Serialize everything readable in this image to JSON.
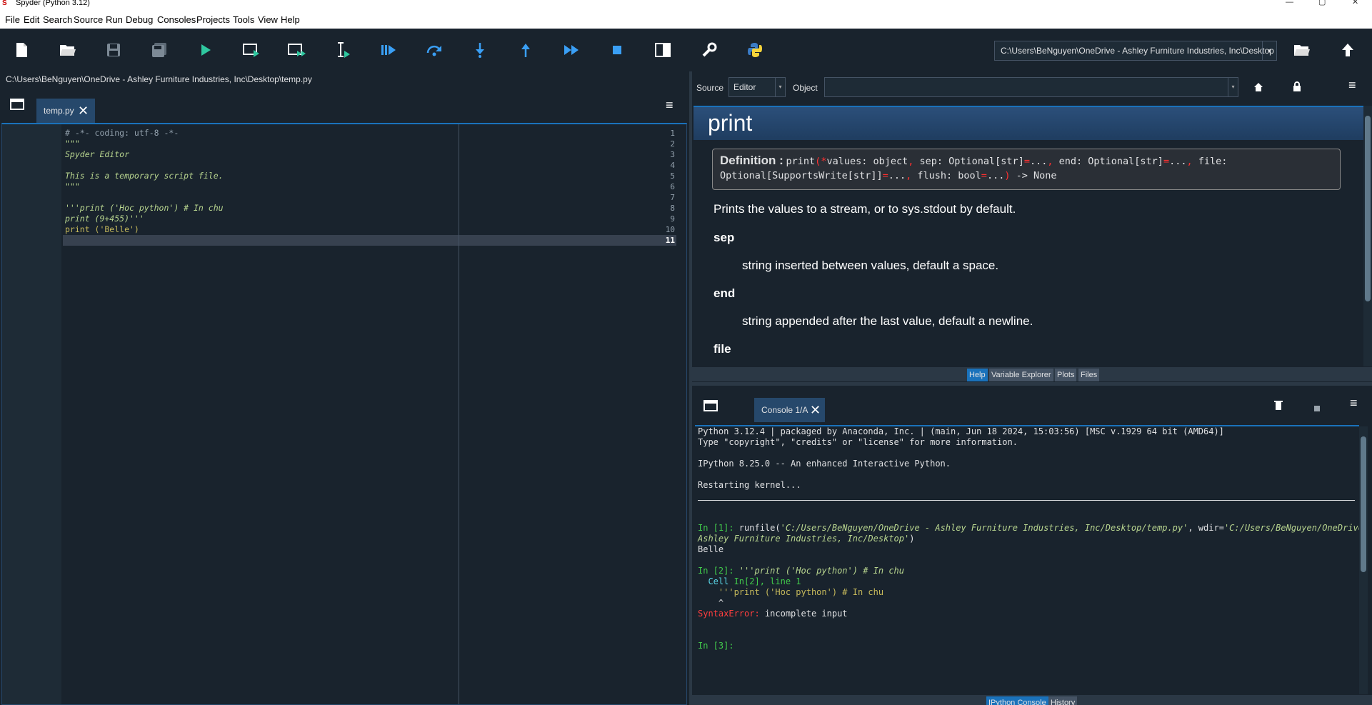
{
  "window": {
    "title": "Spyder (Python 3.12)",
    "logo": "S"
  },
  "menu": [
    "File",
    "Edit",
    "Search",
    "Source",
    "Run",
    "Debug",
    "Consoles",
    "Projects",
    "Tools",
    "View",
    "Help"
  ],
  "toolbar": {
    "icons": [
      "new-file-icon",
      "open-file-icon",
      "save-icon",
      "save-all-icon",
      "run-icon",
      "run-cell-icon",
      "run-cell-advance-icon",
      "run-selection-icon",
      "debug-file-icon",
      "step-over-icon",
      "step-into-icon",
      "step-return-icon",
      "continue-icon",
      "stop-debug-icon",
      "maximize-pane-icon",
      "preferences-wrench-icon",
      "python-path-icon"
    ],
    "working_dir": "C:\\Users\\BeNguyen\\OneDrive - Ashley Furniture Industries, Inc\\Desktop"
  },
  "editor": {
    "path": "C:\\Users\\BeNguyen\\OneDrive - Ashley Furniture Industries, Inc\\Desktop\\temp.py",
    "tab": "temp.py",
    "line_numbers": [
      "1",
      "2",
      "3",
      "4",
      "5",
      "6",
      "7",
      "8",
      "9",
      "10",
      "11"
    ],
    "lines": [
      "# -*- coding: utf-8 -*-",
      "\"\"\"",
      "Spyder Editor",
      "",
      "This is a temporary script file.",
      "\"\"\"",
      "",
      "'''print ('Hoc python') # In chu",
      "print (9+455)'''",
      "print ('Belle')",
      ""
    ],
    "colors": {
      "comment": "#93a1ad",
      "string": "#b8d58f",
      "keyword": "#c6b95b",
      "default": "#e0e1e3"
    }
  },
  "help": {
    "source_label": "Source",
    "source_value": "Editor",
    "object_label": "Object",
    "object_value": "",
    "title": "print",
    "definition_label": "Definition :",
    "definition_parts": [
      {
        "t": "print",
        "c": "n"
      },
      {
        "t": "(",
        "c": "r"
      },
      {
        "t": "*",
        "c": "r"
      },
      {
        "t": "values: object",
        "c": "n"
      },
      {
        "t": ",",
        "c": "r"
      },
      {
        "t": " sep: Optional[str]",
        "c": "n"
      },
      {
        "t": "=",
        "c": "r"
      },
      {
        "t": "...",
        "c": "n"
      },
      {
        "t": ",",
        "c": "r"
      },
      {
        "t": " end: Optional[str]",
        "c": "n"
      },
      {
        "t": "=",
        "c": "r"
      },
      {
        "t": "...",
        "c": "n"
      },
      {
        "t": ",",
        "c": "r"
      },
      {
        "t": " file:",
        "c": "n"
      }
    ],
    "definition_parts2": [
      {
        "t": "Optional[SupportsWrite[str]]",
        "c": "n"
      },
      {
        "t": "=",
        "c": "r"
      },
      {
        "t": "...",
        "c": "n"
      },
      {
        "t": ",",
        "c": "r"
      },
      {
        "t": " flush: bool",
        "c": "n"
      },
      {
        "t": "=",
        "c": "r"
      },
      {
        "t": "...",
        "c": "n"
      },
      {
        "t": ")",
        "c": "r"
      },
      {
        "t": " -> None",
        "c": "n"
      }
    ],
    "summary": "Prints the values to a stream, or to sys.stdout by default.",
    "params": [
      {
        "name": "sep",
        "desc": "string inserted between values, default a space."
      },
      {
        "name": "end",
        "desc": "string appended after the last value, default a newline."
      },
      {
        "name": "file",
        "desc": ""
      }
    ],
    "tabs": [
      "Help",
      "Variable Explorer",
      "Plots",
      "Files"
    ],
    "active_tab": "Help"
  },
  "console": {
    "tab": "Console 1/A",
    "tabs": [
      "IPython Console",
      "History"
    ],
    "active_tab": "IPython Console",
    "banner1": "Python 3.12.4 | packaged by Anaconda, Inc. | (main, Jun 18 2024, 15:03:56) [MSC v.1929 64 bit (AMD64)]",
    "banner2": "Type \"copyright\", \"credits\" or \"license\" for more information.",
    "banner3": "IPython 8.25.0 -- An enhanced Interactive Python.",
    "restart": "Restarting kernel...",
    "in1_prompt": "In [1]:",
    "in1_cmd_a": " runfile(",
    "in1_path": "'C:/Users/BeNguyen/OneDrive - Ashley Furniture Industries, Inc/Desktop/temp.py'",
    "in1_cmd_b": ", wdir=",
    "in1_wdir_a": "'C:/Users/BeNguyen/OneDrive -",
    "in1_wdir_b": "Ashley Furniture Industries, Inc/Desktop'",
    "in1_close": ")",
    "out1": "Belle",
    "in2_prompt": "In [2]:",
    "in2_cmd": " '''print ('Hoc python') # In chu",
    "cell_line_a": "  Cell ",
    "cell_line_b": "In[2], line 1",
    "err_code": "    '''print ('Hoc python') # In chu",
    "err_caret": "    ^",
    "err_name": "SyntaxError:",
    "err_msg": " incomplete input",
    "in3_prompt": "In [3]:"
  }
}
